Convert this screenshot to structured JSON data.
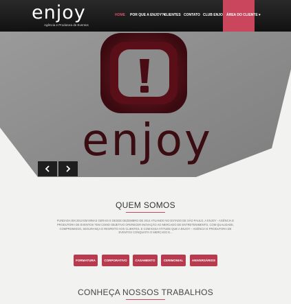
{
  "header": {
    "logo_text": "enjoy",
    "logo_tagline": "Agência e Produtora de Eventos",
    "nav": [
      {
        "label": "HOME",
        "active": true
      },
      {
        "label": "POR QUE A ENJOY?▾",
        "active": false
      },
      {
        "label": "CLIENTES",
        "active": false
      },
      {
        "label": "CONTATO",
        "active": false
      },
      {
        "label": "CLUB ENJOY",
        "active": false
      }
    ],
    "client_area_label": "ÁREA DO CLIENTE ▾"
  },
  "hero": {
    "slide_word": "enjoy",
    "prev_icon": "chevron-left-icon",
    "next_icon": "chevron-right-icon"
  },
  "about": {
    "title": "QUEM SOMOS",
    "body": "FUNDADA EM 2013 EM MINAS GERAIS E DESDE DEZEMBRO DE 2014 ATUANDO NO ESTADO DE SÃO PAULO, A ENJOY - AGÊNCIA E PRODUTORA DE EVENTOS TEM COMO OBJETIVO OFERECER INOVAÇÃO AO MERCADO DE ENTRETENIMENTO, COM QUALIDADE, COMPROMISSO, SEGURANÇA E RESPEITO AOS CLIENTES. E COM ESSA ATITUDE QUE A ENJOY – AGÊNCIA E PRODUTORA DE EVENTOS CONQUISTA O MERCADO E..."
  },
  "categories": [
    "FORMATURA",
    "CORPORATIVO",
    "CASAMENTO",
    "CERIMONIAL",
    "ANIVERSÁRIOS"
  ],
  "works": {
    "title": "CONHEÇA NOSSOS TRABALHOS"
  },
  "colors": {
    "accent": "#c9465c",
    "button": "#b73a4f",
    "header_bg": "#1a1a1a",
    "hero_gray": "#8e8e8e",
    "logo_dark": "#3b0c12"
  }
}
